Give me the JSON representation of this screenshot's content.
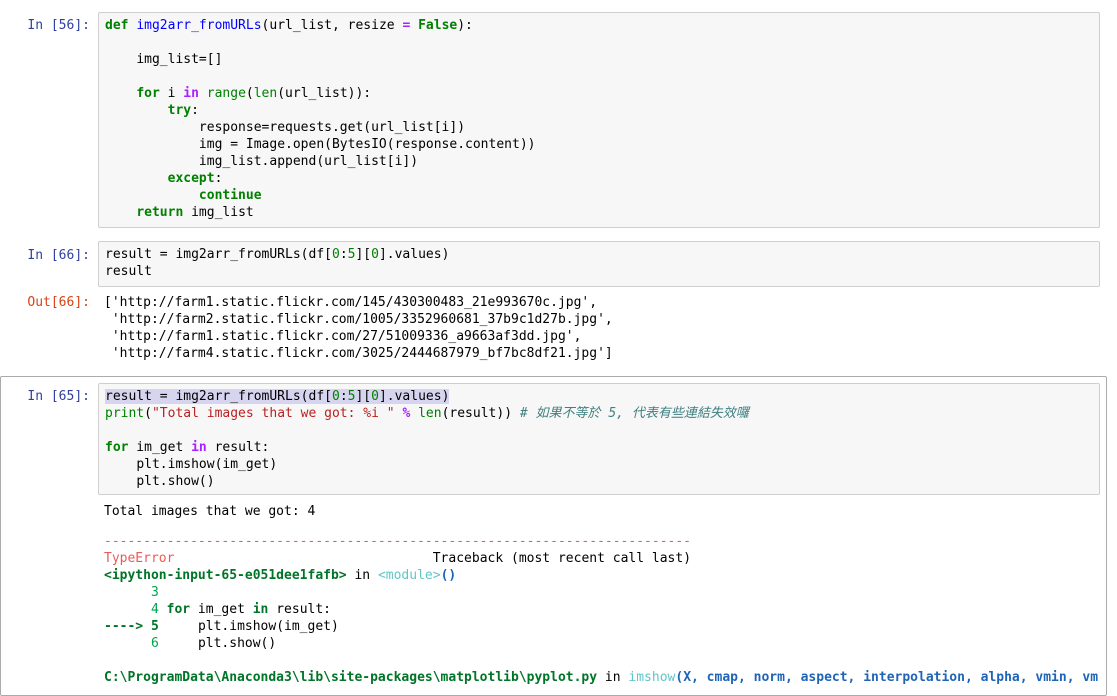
{
  "cells": [
    {
      "prompt": "In [56]:",
      "code": {
        "l1_def": "def",
        "l1_name": "img2arr_fromURLs",
        "l1_args": "(url_list, resize ",
        "l1_eq": "=",
        "l1_sp": " ",
        "l1_false": "False",
        "l1_end": "):",
        "l3": "img_list=[]",
        "l5_for": "for",
        "l5_i": " i ",
        "l5_in": "in",
        "l5_range": "range",
        "l5_p1": "(",
        "l5_len": "len",
        "l5_rest": "(url_list)):",
        "l6_try": "try",
        "l6_colon": ":",
        "l7": "response=requests.get(url_list[i])",
        "l8": "img = Image.open(BytesIO(response.content))",
        "l9": "img_list.append(url_list[i])",
        "l10_except": "except",
        "l10_colon": ":",
        "l11_continue": "continue",
        "l12_return": "return",
        "l12_rest": " img_list"
      }
    },
    {
      "prompt": "In [66]:",
      "code": {
        "l1_a": "result = img2arr_fromURLs(df[",
        "l1_n0": "0",
        "l1_c": ":",
        "l1_n5": "5",
        "l1_b": "][",
        "l1_n0b": "0",
        "l1_end": "].values)",
        "l2": "result"
      },
      "out_prompt": "Out[66]:",
      "output": [
        "['http://farm1.static.flickr.com/145/430300483_21e993670c.jpg',",
        " 'http://farm2.static.flickr.com/1005/3352960681_37b9c1d27b.jpg',",
        " 'http://farm1.static.flickr.com/27/51009336_a9663af3dd.jpg',",
        " 'http://farm4.static.flickr.com/3025/2444687979_bf7bc8df21.jpg']"
      ]
    },
    {
      "prompt": "In [65]:",
      "code": {
        "l1_a": "result = img2arr_fromURLs(df[",
        "l1_n0": "0",
        "l1_c": ":",
        "l1_n5": "5",
        "l1_b": "][",
        "l1_n0b": "0",
        "l1_end": "].values)",
        "l2_print": "print",
        "l2_p": "(",
        "l2_str": "\"Total images that we got: %i \"",
        "l2_sp": " ",
        "l2_mod": "%",
        "l2_sp2": " ",
        "l2_len": "len",
        "l2_rest": "(result)) ",
        "l2_comment": "# 如果不等於 5, 代表有些連結失效囉",
        "l4_for": "for",
        "l4_mid": " im_get ",
        "l4_in": "in",
        "l4_rest": " result:",
        "l5": "plt.imshow(im_get)",
        "l6": "plt.show()"
      },
      "stdout": "Total images that we got: 4",
      "traceback": {
        "dashes": "---------------------------------------------------------------------------",
        "error_name": "TypeError",
        "tb_label": "Traceback (most recent call last)",
        "input_ref": "<ipython-input-65-e051dee1fafb>",
        "in_word": " in ",
        "module": "<module>",
        "module_paren": "()",
        "ln3": "3",
        "ln4": "4",
        "ln4_for": "for",
        "ln4_mid": " im_get ",
        "ln4_in": "in",
        "ln4_rest": " result:",
        "arrow": "----> 5",
        "ln5_code": "plt.imshow(im_get)",
        "ln6": "6",
        "ln6_code": "plt.show()",
        "path": "C:\\ProgramData\\Anaconda3\\lib\\site-packages\\matplotlib\\pyplot.py",
        "path_in": " in ",
        "path_fn": "imshow",
        "path_args": "(X, cmap, norm, aspect, interpolation, alpha, vmin, vm"
      }
    }
  ]
}
